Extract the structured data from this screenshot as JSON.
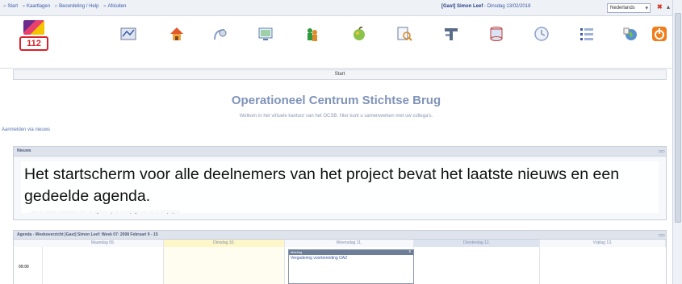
{
  "topbar": {
    "crumbs": [
      "Start",
      "Kaartlagen",
      "Beoordeling / Help",
      "Afsluiten"
    ],
    "user_label": "[Gast]",
    "user_name": "Simon Leef",
    "date": "- Dinsdag 13/02/2018",
    "lang_value": "Nederlands"
  },
  "toolbar": {
    "logo_number": "112",
    "icons": [
      "map-icon",
      "home-icon",
      "satellite-icon",
      "monitor-icon",
      "people-icon",
      "apple-icon",
      "document-search-icon",
      "tools-icon",
      "database-icon",
      "clock-icon",
      "list-icon",
      "globe-icon",
      "power-icon"
    ]
  },
  "section": {
    "title": "Start"
  },
  "welcome": {
    "title": "Operationeel Centrum Stichtse Brug",
    "subtitle": "Welkom in het virtuele kantoor van het OCSB. Hier kunt u samenwerken met uw collega's.",
    "link": "Aanmelden via nieuws"
  },
  "news": {
    "title": "Nieuws",
    "line": "Lees de laatste nieuwsberichten en agenda op de homepage van het OCSB project."
  },
  "caption": {
    "text": "Het startscherm voor alle deelnemers van het project bevat het laatste nieuws en een gedeelde agenda."
  },
  "agenda": {
    "title": "Agenda - Weekoverzicht [Gast] Simon Leef: Week 07: 2008 Februari 9 - 15",
    "days": [
      "Maandag 09.",
      "Dinsdag 10.",
      "Woensdag 11.",
      "Donderdag 12.",
      "Vrijdag 13."
    ],
    "time": "09:00",
    "event_head": "Meeting",
    "event_title": "Vergadering voorbereiding OAZ"
  },
  "colors": {
    "accent": "#3b59a8",
    "title": "#7f93b9",
    "highlight_day": "#fdf6c8",
    "today": "#dde4f0"
  }
}
